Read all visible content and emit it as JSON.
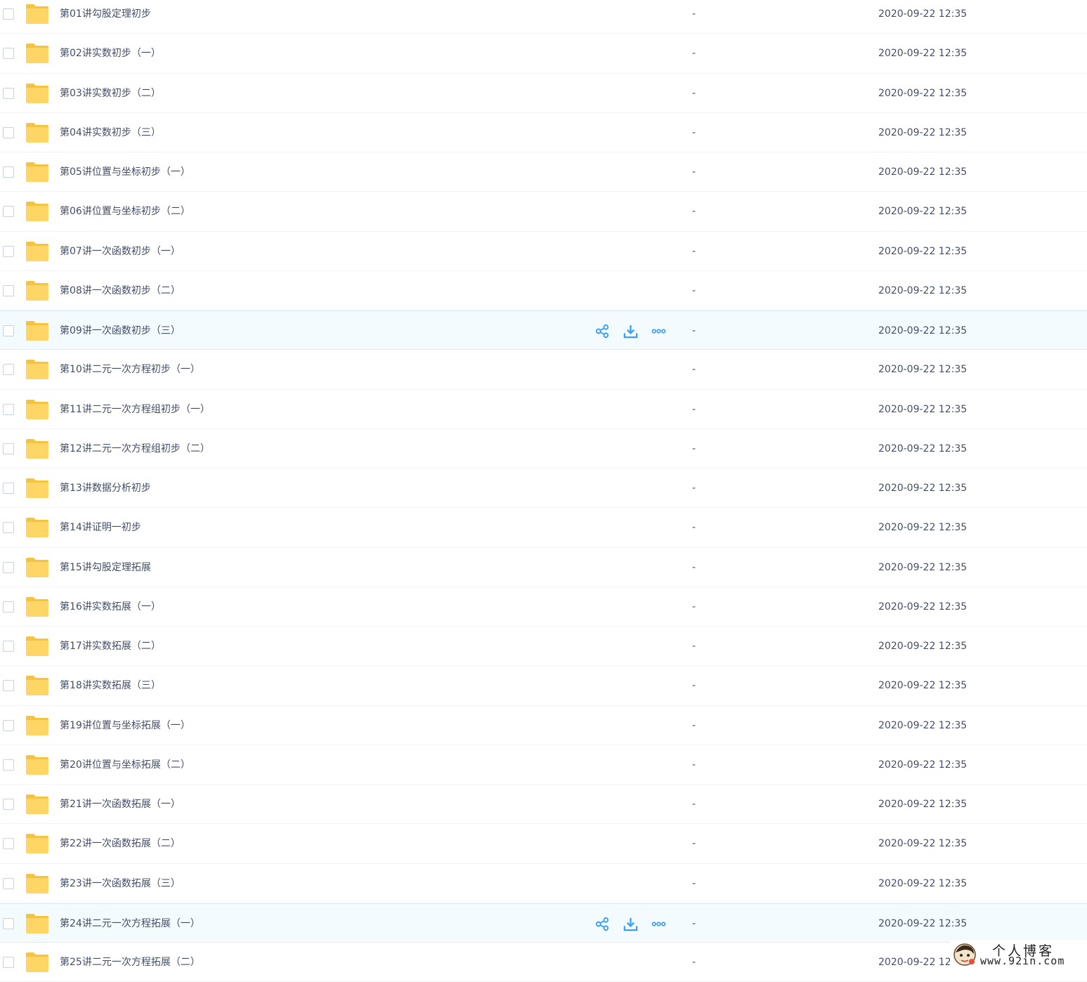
{
  "colors": {
    "accent": "#3b9ff3",
    "folder": "#ffd666",
    "folder_dark": "#f5c342",
    "hover_row": "#f4fbff"
  },
  "icons": {
    "share": "share-icon",
    "download": "download-icon",
    "more": "more-icon",
    "folder": "folder-icon"
  },
  "files": [
    {
      "name": "第01讲勾股定理初步",
      "size": "-",
      "date": "2020-09-22 12:35",
      "hover": false
    },
    {
      "name": "第02讲实数初步（一）",
      "size": "-",
      "date": "2020-09-22 12:35",
      "hover": false
    },
    {
      "name": "第03讲实数初步（二）",
      "size": "-",
      "date": "2020-09-22 12:35",
      "hover": false
    },
    {
      "name": "第04讲实数初步（三）",
      "size": "-",
      "date": "2020-09-22 12:35",
      "hover": false
    },
    {
      "name": "第05讲位置与坐标初步（一）",
      "size": "-",
      "date": "2020-09-22 12:35",
      "hover": false
    },
    {
      "name": "第06讲位置与坐标初步（二）",
      "size": "-",
      "date": "2020-09-22 12:35",
      "hover": false
    },
    {
      "name": "第07讲一次函数初步（一）",
      "size": "-",
      "date": "2020-09-22 12:35",
      "hover": false
    },
    {
      "name": "第08讲一次函数初步（二）",
      "size": "-",
      "date": "2020-09-22 12:35",
      "hover": false
    },
    {
      "name": "第09讲一次函数初步（三）",
      "size": "-",
      "date": "2020-09-22 12:35",
      "hover": true
    },
    {
      "name": "第10讲二元一次方程初步（一）",
      "size": "-",
      "date": "2020-09-22 12:35",
      "hover": false
    },
    {
      "name": "第11讲二元一次方程组初步（一）",
      "size": "-",
      "date": "2020-09-22 12:35",
      "hover": false
    },
    {
      "name": "第12讲二元一次方程组初步（二）",
      "size": "-",
      "date": "2020-09-22 12:35",
      "hover": false
    },
    {
      "name": "第13讲数据分析初步",
      "size": "-",
      "date": "2020-09-22 12:35",
      "hover": false
    },
    {
      "name": "第14讲证明一初步",
      "size": "-",
      "date": "2020-09-22 12:35",
      "hover": false
    },
    {
      "name": "第15讲勾股定理拓展",
      "size": "-",
      "date": "2020-09-22 12:35",
      "hover": false
    },
    {
      "name": "第16讲实数拓展（一）",
      "size": "-",
      "date": "2020-09-22 12:35",
      "hover": false
    },
    {
      "name": "第17讲实数拓展（二）",
      "size": "-",
      "date": "2020-09-22 12:35",
      "hover": false
    },
    {
      "name": "第18讲实数拓展（三）",
      "size": "-",
      "date": "2020-09-22 12:35",
      "hover": false
    },
    {
      "name": "第19讲位置与坐标拓展（一）",
      "size": "-",
      "date": "2020-09-22 12:35",
      "hover": false
    },
    {
      "name": "第20讲位置与坐标拓展（二）",
      "size": "-",
      "date": "2020-09-22 12:35",
      "hover": false
    },
    {
      "name": "第21讲一次函数拓展（一）",
      "size": "-",
      "date": "2020-09-22 12:35",
      "hover": false
    },
    {
      "name": "第22讲一次函数拓展（二）",
      "size": "-",
      "date": "2020-09-22 12:35",
      "hover": false
    },
    {
      "name": "第23讲一次函数拓展（三）",
      "size": "-",
      "date": "2020-09-22 12:35",
      "hover": false
    },
    {
      "name": "第24讲二元一次方程拓展（一）",
      "size": "-",
      "date": "2020-09-22 12:35",
      "hover": true
    },
    {
      "name": "第25讲二元一次方程拓展（二）",
      "size": "-",
      "date": "2020-09-22 12",
      "hover": false
    }
  ],
  "watermark": {
    "title": "个人博客",
    "url": "www.92in.com"
  }
}
